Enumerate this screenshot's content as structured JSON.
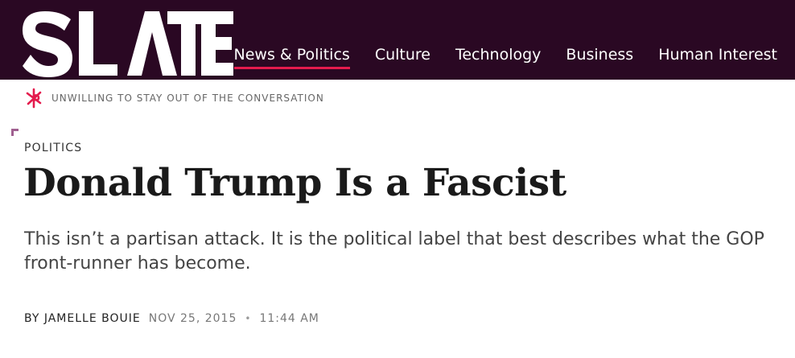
{
  "header": {
    "logo_text": "SLATE",
    "nav": [
      {
        "label": "News & Politics",
        "active": true
      },
      {
        "label": "Culture",
        "active": false
      },
      {
        "label": "Technology",
        "active": false
      },
      {
        "label": "Business",
        "active": false
      },
      {
        "label": "Human Interest",
        "active": false
      }
    ]
  },
  "tagline": {
    "text": "UNWILLING TO STAY OUT OF THE CONVERSATION",
    "icon": "slate-burst-icon"
  },
  "article": {
    "section": "POLITICS",
    "headline": "Donald Trump Is a Fascist",
    "dek": "This isn’t a partisan attack. It is the political label that best describes what the GOP front-runner has become.",
    "byline": {
      "author": "BY JAMELLE BOUIE",
      "date": "NOV 25, 2015",
      "separator": "•",
      "time": "11:44 AM"
    }
  },
  "colors": {
    "header_bg": "#2a0823",
    "accent": "#e41b4d",
    "corner_mark": "#a06090"
  }
}
